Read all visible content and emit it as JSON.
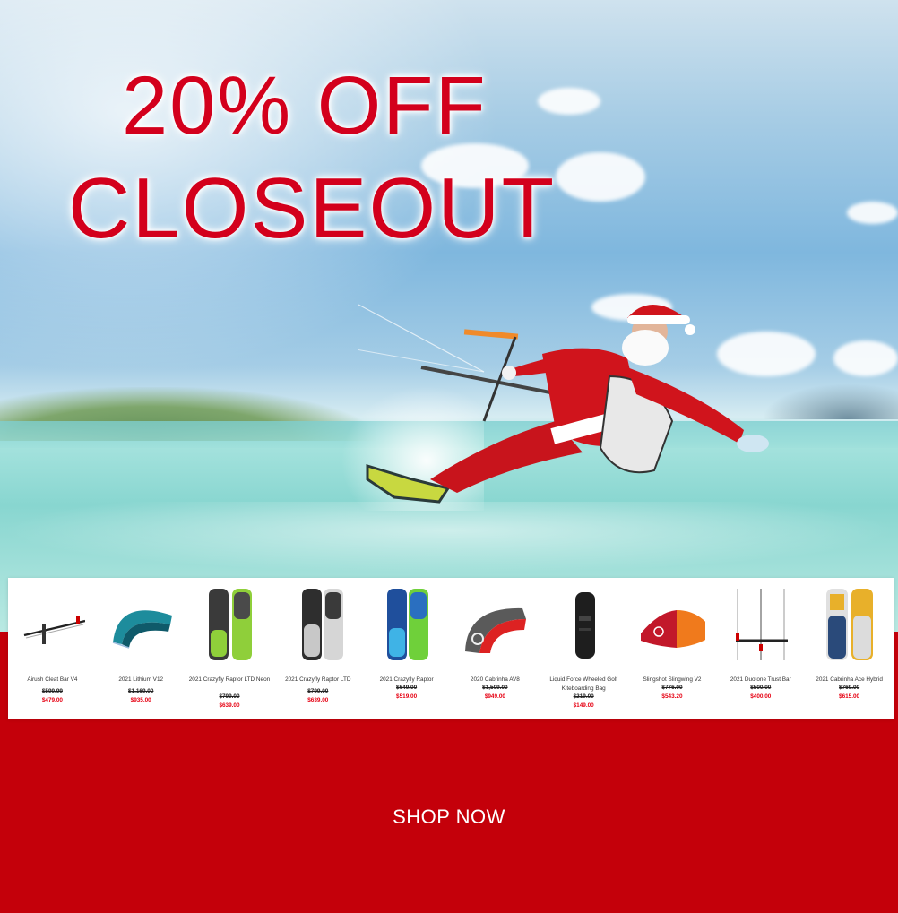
{
  "headline": {
    "line1": "20% OFF",
    "line2": "CLOSEOUT"
  },
  "cta": {
    "label": "SHOP NOW"
  },
  "products": [
    {
      "name": "Airush Cleat Bar V4",
      "old_price": "$599.99",
      "sale_price": "$479.00",
      "icon": "control-bar-icon"
    },
    {
      "name": "2021 Lithium V12",
      "old_price": "$1,169.00",
      "sale_price": "$935.00",
      "icon": "kite-icon"
    },
    {
      "name": "2021 Crazyfly Raptor LTD Neon",
      "old_price": "$799.00",
      "sale_price": "$639.00",
      "icon": "kiteboard-icon"
    },
    {
      "name": "2021 Crazyfly Raptor LTD",
      "old_price": "$799.00",
      "sale_price": "$639.00",
      "icon": "kiteboard-icon"
    },
    {
      "name": "2021 Crazyfly Raptor",
      "old_price": "$649.00",
      "sale_price": "$519.00",
      "icon": "kiteboard-icon"
    },
    {
      "name": "2020 Cabrinha AV8",
      "old_price": "$1,509.00",
      "sale_price": "$949.00",
      "icon": "kite-icon"
    },
    {
      "name": "Liquid Force Wheeled Golf Kiteboarding Bag",
      "old_price": "$219.00",
      "sale_price": "$149.00",
      "icon": "board-bag-icon"
    },
    {
      "name": "Slingshot Slingwing V2",
      "old_price": "$776.00",
      "sale_price": "$543.20",
      "icon": "wing-icon"
    },
    {
      "name": "2021 Duotone Trust Bar",
      "old_price": "$500.00",
      "sale_price": "$400.00",
      "icon": "control-bar-icon"
    },
    {
      "name": "2021 Cabrinha Ace Hybrid",
      "old_price": "$769.00",
      "sale_price": "$615.00",
      "icon": "kiteboard-icon"
    }
  ],
  "colors": {
    "brand_red": "#c4000a",
    "headline_red": "#d3001c",
    "sale_red": "#e60012"
  }
}
